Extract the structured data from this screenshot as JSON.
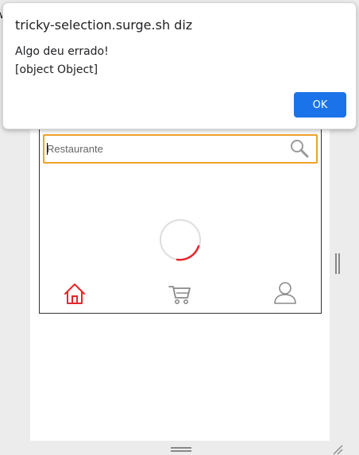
{
  "browser": {
    "left_edge_text": "w"
  },
  "dialog": {
    "title": "tricky-selection.surge.sh diz",
    "message_line1": "Algo deu errado!",
    "message_line2": "[object Object]",
    "ok_label": "OK"
  },
  "app": {
    "search": {
      "placeholder": "Restaurante",
      "value": ""
    },
    "loading": true,
    "nav": {
      "items": [
        {
          "icon": "home-icon",
          "active": true
        },
        {
          "icon": "cart-icon",
          "active": false
        },
        {
          "icon": "user-icon",
          "active": false
        }
      ]
    }
  },
  "colors": {
    "accent": "#e8252a",
    "search_border": "#f0a22a",
    "dialog_button": "#1a73e8",
    "inactive_icon": "#8a8a8a"
  }
}
